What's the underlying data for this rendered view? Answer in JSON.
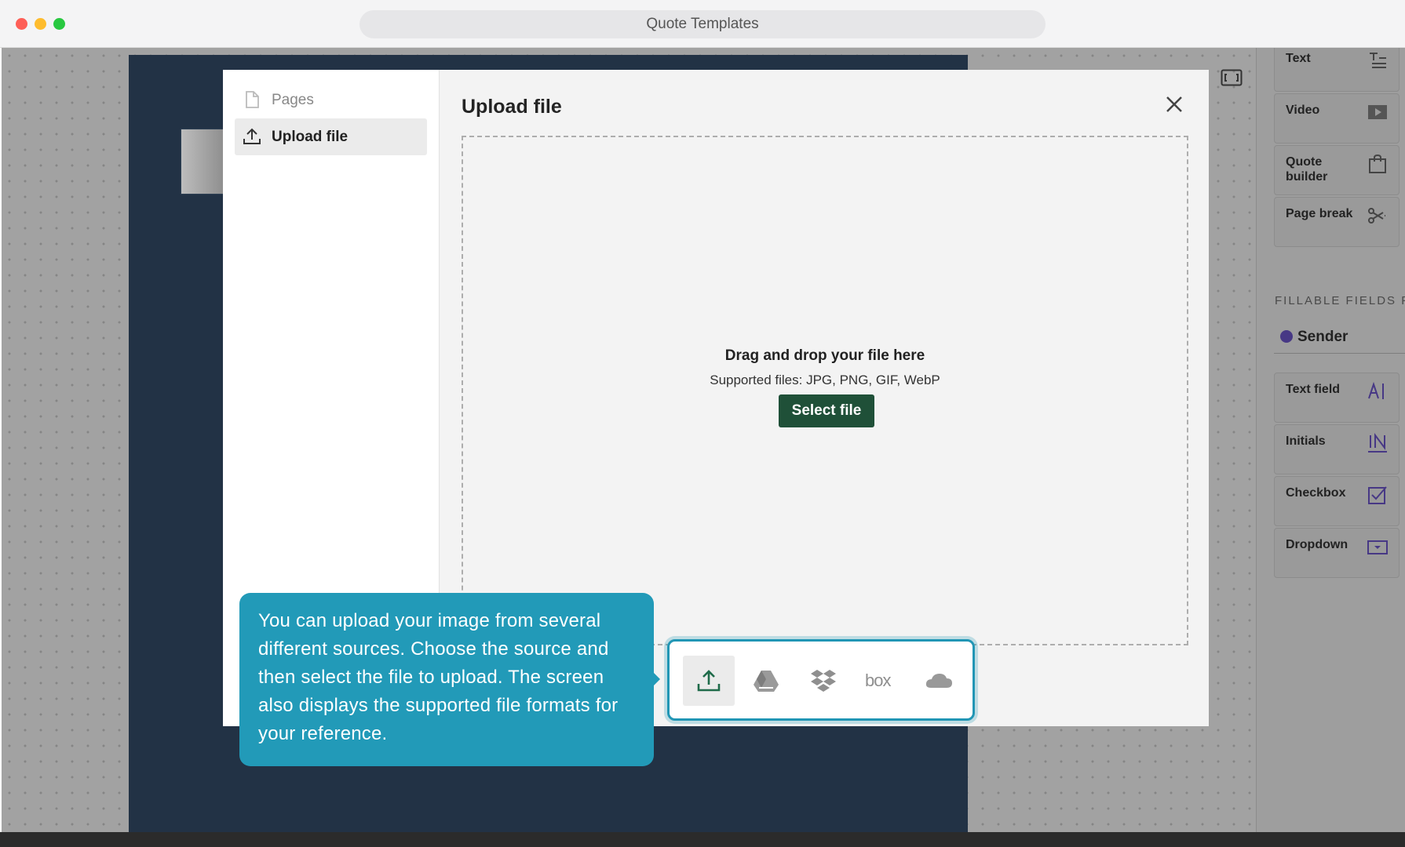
{
  "window": {
    "title": "Quote Templates"
  },
  "sidebar": {
    "content_blocks": [
      {
        "label": "Text",
        "icon": "text-icon"
      },
      {
        "label": "Video",
        "icon": "video-icon"
      },
      {
        "label": "Quote builder",
        "icon": "shopping-bag-icon"
      },
      {
        "label": "Page break",
        "icon": "scissors-icon"
      }
    ],
    "fillable_section_label": "FILLABLE FIELDS FOR",
    "sender_label": "Sender",
    "sender_color": "#473885",
    "fillable_fields": [
      {
        "label": "Text field",
        "icon": "text-field-icon"
      },
      {
        "label": "Initials",
        "icon": "initials-icon"
      },
      {
        "label": "Checkbox",
        "icon": "checkbox-icon"
      },
      {
        "label": "Dropdown",
        "icon": "dropdown-icon"
      }
    ]
  },
  "modal": {
    "nav": [
      {
        "label": "Pages",
        "icon": "page-icon",
        "active": false
      },
      {
        "label": "Upload file",
        "icon": "upload-icon",
        "active": true
      }
    ],
    "title": "Upload file",
    "dropzone": {
      "heading": "Drag and drop your file here",
      "supported": "Supported files: JPG, PNG, GIF, WebP",
      "button_label": "Select file"
    },
    "sources": [
      {
        "name": "upload-computer-icon",
        "active": true
      },
      {
        "name": "google-drive-icon",
        "active": false
      },
      {
        "name": "dropbox-icon",
        "active": false
      },
      {
        "name": "box-icon",
        "active": false
      },
      {
        "name": "onedrive-cloud-icon",
        "active": false
      }
    ],
    "accent_color": "#1f5038"
  },
  "tooltip": {
    "text": "You can upload your image from several different sources. Choose the source and then select the file to upload. The screen also displays the supported file formats for your reference.",
    "color": "#229ab8"
  }
}
